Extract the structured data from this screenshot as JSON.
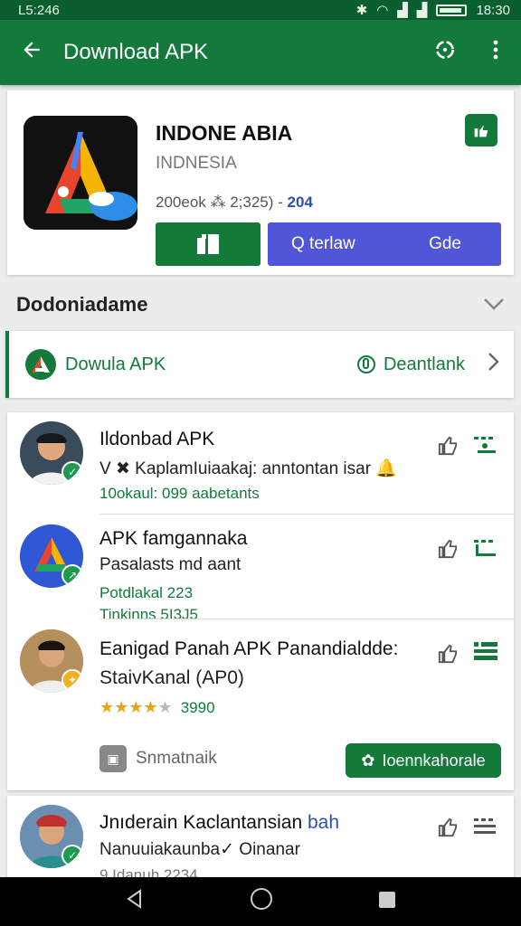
{
  "status_bar": {
    "time_left": "L5:246",
    "time_right": "18:30"
  },
  "app_bar": {
    "title": "Download APK"
  },
  "app": {
    "name": "INDONE ABIA",
    "publisher": "INDNESIA",
    "meta": "200eok ⁂ 2;325)  -",
    "count": "204",
    "install_icon": "install-icon",
    "search_label": "Q terlaw",
    "open_label": "Gde"
  },
  "section": {
    "title": "Dodoniadame"
  },
  "download_row": {
    "label": "Dowula APK",
    "right_label": "Deantlank"
  },
  "items": [
    {
      "title": "Ildonbad APK",
      "line": "V ✖ KaplamIuiaakaj: anntontan isar",
      "stats": "10okaul: 099  aabetants"
    },
    {
      "title": "APK famgannaka",
      "line": "Pasalasts md aant",
      "stats": "Potdlakal 223",
      "stats2": "Tinkinns 5I3J5"
    },
    {
      "title": "Eanigad Panah APK  Panandialdde:",
      "line": "StaivKanal (AP0)",
      "rating": 4,
      "rating_count": "3990",
      "similar_label": "Snmatnaik",
      "download_label": "Ioennkahorale"
    },
    {
      "title": "Jnıderain Kaclantansian",
      "title_accent": "bah",
      "line": "Nanuuiakaunba✓ Oinanar",
      "stats": "9  Idanuh  2234"
    }
  ],
  "colors": {
    "primary": "#137a3c",
    "accent": "#5056d8",
    "star": "#e8a316"
  }
}
